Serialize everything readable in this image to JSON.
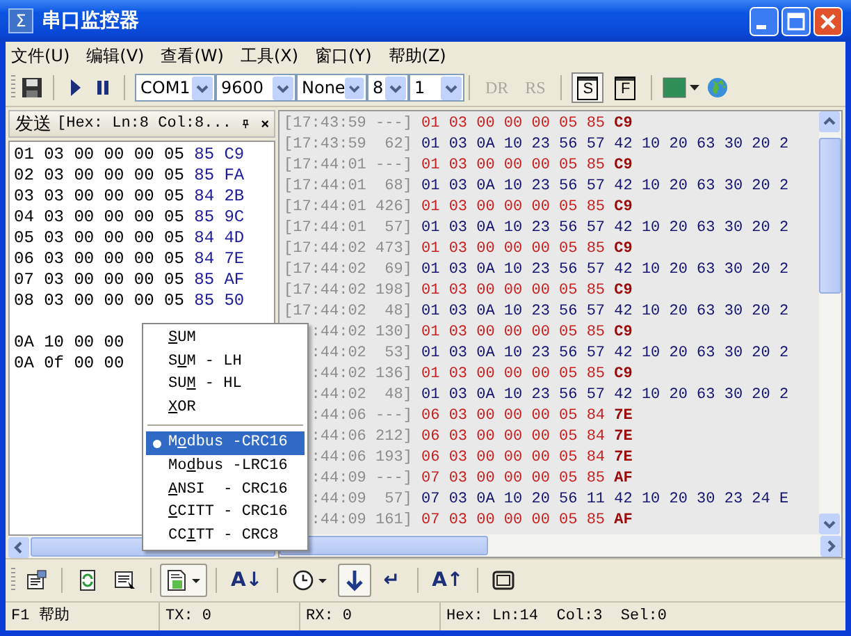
{
  "window": {
    "icon": "Σ",
    "title": "串口监控器"
  },
  "menu_bar": [
    "文件(U)",
    "编辑(V)",
    "查看(W)",
    "工具(X)",
    "窗口(Y)",
    "帮助(Z)"
  ],
  "toolbar": {
    "port_settings": [
      {
        "value": "COM1"
      },
      {
        "value": "9600"
      },
      {
        "value": "None"
      },
      {
        "value": "8"
      },
      {
        "value": "1"
      }
    ],
    "signals": [
      {
        "label": "DR",
        "disabled": true
      },
      {
        "label": "RS",
        "disabled": true
      }
    ],
    "mode_buttons": [
      {
        "label": "S",
        "pressed": true
      },
      {
        "label": "F",
        "pressed": false
      }
    ]
  },
  "send_panel": {
    "title": "发送",
    "info": "[Hex: Ln:8 Col:8...",
    "rows": [
      {
        "kind": "frame",
        "data": "01 03 00 00 00 05",
        "crc": "85 C9"
      },
      {
        "kind": "frame",
        "data": "02 03 00 00 00 05",
        "crc": "85 FA"
      },
      {
        "kind": "frame",
        "data": "03 03 00 00 00 05",
        "crc": "84 2B"
      },
      {
        "kind": "frame",
        "data": "04 03 00 00 00 05",
        "crc": "85 9C"
      },
      {
        "kind": "frame",
        "data": "05 03 00 00 00 05",
        "crc": "84 4D"
      },
      {
        "kind": "frame",
        "data": "06 03 00 00 00 05",
        "crc": "84 7E"
      },
      {
        "kind": "frame",
        "data": "07 03 00 00 00 05",
        "crc": "85 AF"
      },
      {
        "kind": "frame",
        "data": "08 03 00 00 00 05",
        "crc": "85 50"
      },
      {
        "kind": "blank"
      },
      {
        "kind": "frame",
        "data": "0A 10 00 00"
      },
      {
        "kind": "frame",
        "data": "0A 0f 00 00"
      }
    ]
  },
  "log": [
    {
      "sent": true,
      "time": "[17:43:59",
      "len": "---]",
      "data": "01 03 00 00 00 05 85",
      "crc": "C9"
    },
    {
      "sent": false,
      "time": "[17:43:59",
      "len": "62]",
      "data": "01 03 0A 10 23 56 57 42 10 20 63 30 20 2"
    },
    {
      "sent": true,
      "time": "[17:44:01",
      "len": "---]",
      "data": "01 03 00 00 00 05 85",
      "crc": "C9"
    },
    {
      "sent": false,
      "time": "[17:44:01",
      "len": "68]",
      "data": "01 03 0A 10 23 56 57 42 10 20 63 30 20 2"
    },
    {
      "sent": true,
      "time": "[17:44:01",
      "len": "426]",
      "data": "01 03 00 00 00 05 85",
      "crc": "C9"
    },
    {
      "sent": false,
      "time": "[17:44:01",
      "len": "57]",
      "data": "01 03 0A 10 23 56 57 42 10 20 63 30 20 2"
    },
    {
      "sent": true,
      "time": "[17:44:02",
      "len": "473]",
      "data": "01 03 00 00 00 05 85",
      "crc": "C9"
    },
    {
      "sent": false,
      "time": "[17:44:02",
      "len": "69]",
      "data": "01 03 0A 10 23 56 57 42 10 20 63 30 20 2"
    },
    {
      "sent": true,
      "time": "[17:44:02",
      "len": "198]",
      "data": "01 03 00 00 00 05 85",
      "crc": "C9"
    },
    {
      "sent": false,
      "time": "[17:44:02",
      "len": "48]",
      "data": "01 03 0A 10 23 56 57 42 10 20 63 30 20 2"
    },
    {
      "sent": true,
      "time": ":44:02",
      "len": "130]",
      "data": "01 03 00 00 00 05 85",
      "crc": "C9"
    },
    {
      "sent": false,
      "time": ":44:02",
      "len": "53]",
      "data": "01 03 0A 10 23 56 57 42 10 20 63 30 20 2"
    },
    {
      "sent": true,
      "time": ":44:02",
      "len": "136]",
      "data": "01 03 00 00 00 05 85",
      "crc": "C9"
    },
    {
      "sent": false,
      "time": ":44:02",
      "len": "48]",
      "data": "01 03 0A 10 23 56 57 42 10 20 63 30 20 2"
    },
    {
      "sent": true,
      "time": ":44:06",
      "len": "---]",
      "data": "06 03 00 00 00 05 84",
      "crc": "7E"
    },
    {
      "sent": true,
      "time": ":44:06",
      "len": "212]",
      "data": "06 03 00 00 00 05 84",
      "crc": "7E"
    },
    {
      "sent": true,
      "time": ":44:06",
      "len": "193]",
      "data": "06 03 00 00 00 05 84",
      "crc": "7E"
    },
    {
      "sent": true,
      "time": ":44:09",
      "len": "---]",
      "data": "07 03 00 00 00 05 85",
      "crc": "AF"
    },
    {
      "sent": false,
      "time": ":44:09",
      "len": "57]",
      "data": "07 03 0A 10 20 56 11 42 10 20 30 23 24 E"
    },
    {
      "sent": true,
      "time": ":44:09",
      "len": "161]",
      "data": "07 03 00 00 00 05 85",
      "crc": "AF"
    }
  ],
  "checksum_menu": [
    {
      "key": "S",
      "post": "UM",
      "selected": false,
      "separator_after": false
    },
    {
      "pre": "S",
      "key": "U",
      "post": "M - LH",
      "selected": false,
      "separator_after": false
    },
    {
      "pre": "SU",
      "key": "M",
      "post": " - HL",
      "selected": false,
      "separator_after": false
    },
    {
      "key": "X",
      "post": "OR",
      "selected": false,
      "separator_after": true
    },
    {
      "pre": "M",
      "key": "o",
      "post": "dbus -CRC16",
      "selected": true,
      "separator_after": false
    },
    {
      "pre": "Mo",
      "key": "d",
      "post": "bus -LRC16",
      "selected": false,
      "separator_after": false
    },
    {
      "key": "A",
      "post": "NSI  - CRC16",
      "selected": false,
      "separator_after": false
    },
    {
      "key": "C",
      "post": "CITT - CRC16",
      "selected": false,
      "separator_after": false
    },
    {
      "pre": "CC",
      "key": "I",
      "post": "TT - CRC8",
      "selected": false,
      "separator_after": false
    }
  ],
  "bottom_toolbar": [
    {
      "kind": "properties",
      "pressed": false
    },
    {
      "kind": "refresh",
      "pressed": false
    },
    {
      "kind": "list",
      "pressed": false
    },
    {
      "kind": "document-dropdown",
      "pressed": true
    },
    {
      "kind": "glyph",
      "text": "A↓",
      "pressed": false
    },
    {
      "kind": "clock-dropdown",
      "pressed": false
    },
    {
      "kind": "down-arrow",
      "pressed": true
    },
    {
      "kind": "glyph",
      "text": "↵",
      "pressed": false
    },
    {
      "kind": "glyph",
      "text": "A↑",
      "pressed": false
    },
    {
      "kind": "window",
      "pressed": false
    }
  ],
  "status_bar": [
    "F1 帮助",
    "TX: 0",
    "RX: 0",
    "Hex: Ln:14  Col:3  Sel:0"
  ]
}
